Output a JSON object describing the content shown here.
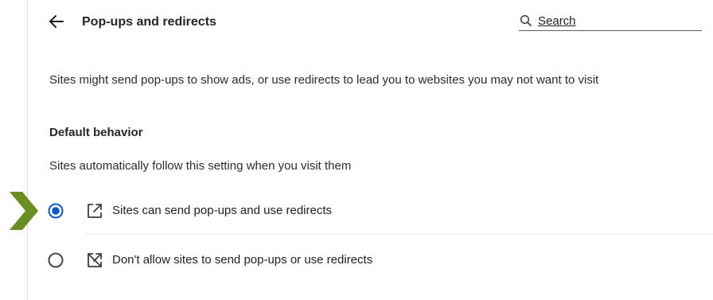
{
  "header": {
    "back_icon": "arrow-left-icon",
    "title": "Pop-ups and redirects",
    "search": {
      "icon": "search-icon",
      "label": "Search"
    }
  },
  "main": {
    "description": "Sites might send pop-ups to show ads, or use redirects to lead you to websites you may not want to visit",
    "default_behavior": {
      "title": "Default behavior",
      "subtitle": "Sites automatically follow this setting when you visit them",
      "options": [
        {
          "label": "Sites can send pop-ups and use redirects",
          "icon": "open-in-new-window-icon",
          "selected": true
        },
        {
          "label": "Don't allow sites to send pop-ups or use redirects",
          "icon": "block-pop-up-icon",
          "selected": false
        }
      ]
    }
  },
  "colors": {
    "accent": "#0b57d0",
    "pointer": "#6b8e23",
    "text": "#1f1f1f"
  }
}
